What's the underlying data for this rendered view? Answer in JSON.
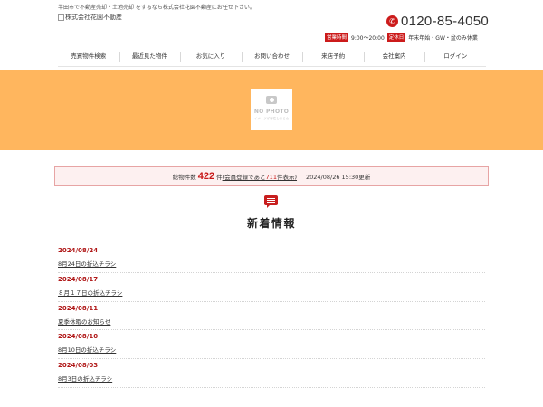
{
  "header": {
    "tagline": "半田市で不動産売却・土地売却 をするなら株式会社花園不動産にお任せ下さい。",
    "logo_alt": "株式会社花園不動産",
    "phone": "0120-85-4050",
    "hours_badge": "営業時間",
    "hours_value": "9:00～20:00",
    "closed_badge": "定休日",
    "closed_value": "年末年始・GW・盆のみ休業"
  },
  "nav": {
    "items": [
      {
        "label": "売買物件検索"
      },
      {
        "label": "最近見た物件"
      },
      {
        "label": "お気に入り"
      },
      {
        "label": "お問い合わせ"
      },
      {
        "label": "来店予約"
      },
      {
        "label": "会社案内"
      },
      {
        "label": "ログイン"
      }
    ]
  },
  "hero": {
    "nophoto_title": "NO PHOTO",
    "nophoto_sub": "イメージが存在しません"
  },
  "stats": {
    "prefix": "総物件数",
    "count": "422",
    "suffix": "件",
    "link_open": "(会員登録であと",
    "hidden_count": "711",
    "link_close": "件表示)",
    "updated": "2024/08/26 15:30更新"
  },
  "news": {
    "title": "新着情報",
    "items": [
      {
        "date": "2024/08/24",
        "text": "8月24日の折込チラシ"
      },
      {
        "date": "2024/08/17",
        "text": "８月１７日の折込チラシ"
      },
      {
        "date": "2024/08/11",
        "text": "夏季休暇のお知らせ"
      },
      {
        "date": "2024/08/10",
        "text": "8月10日の折込チラシ"
      },
      {
        "date": "2024/08/03",
        "text": "8月3日の折込チラシ"
      }
    ]
  },
  "colors": {
    "accent_red": "#cc1b1b",
    "hero_orange": "#ffb65e"
  }
}
